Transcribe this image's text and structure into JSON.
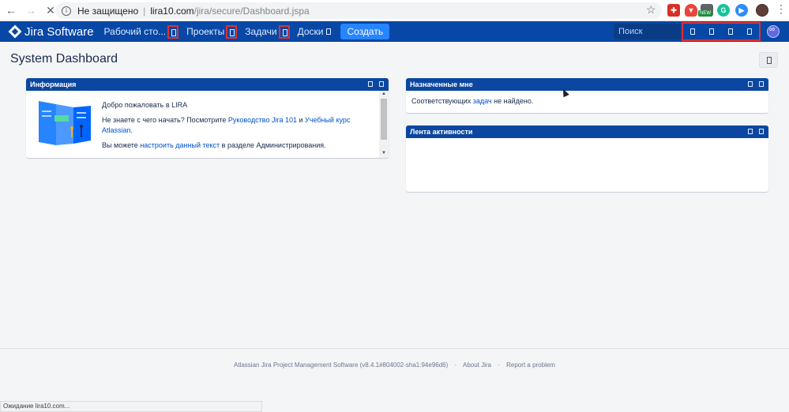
{
  "browser": {
    "security_label": "Не защищено",
    "url_host": "lira10.com",
    "url_path": "/jira/secure/Dashboard.jspa",
    "new_badge": "NEW",
    "status_text": "Ожидание lira10.com..."
  },
  "header": {
    "logo_text": "Jira Software",
    "menu": [
      {
        "label": "Рабочий сто..."
      },
      {
        "label": "Проекты"
      },
      {
        "label": "Задачи"
      },
      {
        "label": "Доски"
      }
    ],
    "create_label": "Создать",
    "search_placeholder": "Поиск"
  },
  "dashboard": {
    "title": "System Dashboard"
  },
  "gadgets": {
    "info": {
      "title": "Информация",
      "welcome": "Добро пожаловать в LIRA",
      "line2_pre": "Не знаете с чего начать? Посмотрите ",
      "line2_link1": "Руководство Jira 101",
      "line2_mid": " и ",
      "line2_link2": "Учебный курс Atlassian",
      "line2_post": ".",
      "line3_pre": "Вы можете ",
      "line3_link": "настроить данный текст",
      "line3_post": " в разделе Администрирования."
    },
    "assigned": {
      "title": "Назначенные мне",
      "text_pre": "Соответствующих ",
      "text_link": "задач",
      "text_post": " не найдено."
    },
    "stream": {
      "title": "Лента активности"
    }
  },
  "footer": {
    "version": "Atlassian Jira Project Management Software (v8.4.1#804002-sha1:94e96d6)",
    "about": "About Jira",
    "report": "Report a problem"
  }
}
